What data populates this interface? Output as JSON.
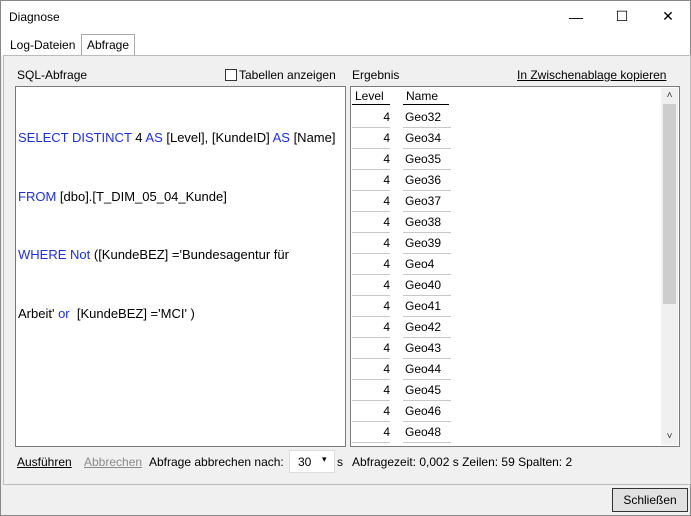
{
  "window": {
    "title": "Diagnose",
    "minimize": "—",
    "maximize": "☐",
    "close": "✕"
  },
  "tabs": [
    {
      "label": "Log-Dateien"
    },
    {
      "label": "Abfrage"
    }
  ],
  "sql": {
    "label": "SQL-Abfrage",
    "show_tables_label": "Tabellen anzeigen",
    "lines": [
      {
        "kw1": "SELECT DISTINCT",
        "t1": " 4 ",
        "kw2": "AS",
        "t2": " [Level], [KundeID] ",
        "kw3": "AS",
        "t3": " [Name]"
      },
      {
        "kw1": "FROM",
        "t1": " [dbo].[T_DIM_05_04_Kunde]"
      },
      {
        "kw1": "WHERE",
        "t1": " ",
        "kw2": "Not",
        "t2": " ([KundeBEZ] ='Bundesagentur für"
      },
      {
        "t1": "Arbeit' ",
        "kw2": "or",
        "t2": "  [KundeBEZ] ='MCI' )"
      }
    ]
  },
  "result": {
    "label": "Ergebnis",
    "copy_label": "In Zwischenablage kopieren",
    "columns": [
      "Level",
      "Name"
    ],
    "rows": [
      {
        "level": "4",
        "name": "Geo32"
      },
      {
        "level": "4",
        "name": "Geo34"
      },
      {
        "level": "4",
        "name": "Geo35"
      },
      {
        "level": "4",
        "name": "Geo36"
      },
      {
        "level": "4",
        "name": "Geo37"
      },
      {
        "level": "4",
        "name": "Geo38"
      },
      {
        "level": "4",
        "name": "Geo39"
      },
      {
        "level": "4",
        "name": "Geo4"
      },
      {
        "level": "4",
        "name": "Geo40"
      },
      {
        "level": "4",
        "name": "Geo41"
      },
      {
        "level": "4",
        "name": "Geo42"
      },
      {
        "level": "4",
        "name": "Geo43"
      },
      {
        "level": "4",
        "name": "Geo44"
      },
      {
        "level": "4",
        "name": "Geo45"
      },
      {
        "level": "4",
        "name": "Geo46"
      },
      {
        "level": "4",
        "name": "Geo48"
      }
    ],
    "scroll_up": "˄",
    "scroll_down": "˅"
  },
  "bottom": {
    "execute": "Ausführen",
    "cancel": "Abbrechen",
    "timeout_label": "Abfrage abbrechen nach:",
    "timeout_value": "30",
    "timeout_unit": "s",
    "status": "Abfragezeit: 0,002 s Zeilen: 59 Spalten: 2",
    "close": "Schließen"
  }
}
